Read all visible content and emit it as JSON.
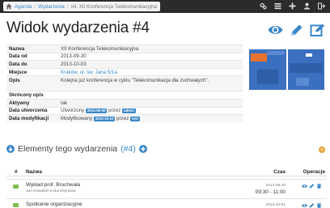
{
  "breadcrumb": {
    "items": [
      "Agenda",
      "Wydarzenia"
    ],
    "current": "#4. XII Konferencja Telekomunikacyjna"
  },
  "page": {
    "title": "Widok wydarzenia #4"
  },
  "details": {
    "name_label": "Nazwa",
    "name_value": "XII Konferencja Telekomunikacyjna",
    "date_from_label": "Data od",
    "date_from_value": "2013-09-30",
    "date_to_label": "Data do",
    "date_to_value": "2013-10-03",
    "place_label": "Miejsce",
    "place_value": "Kraków, ul. św. Jana 5/1a",
    "desc_label": "Opis",
    "desc_value": "Kolejna już konferencja w cyklu \"Telekomunikacja dla zuchwałych\".",
    "short_label": "Skrócony opis",
    "short_value": "",
    "active_label": "Aktywny",
    "active_value": "tak",
    "created_label": "Data utworzenia",
    "created_prefix": "Utworzony",
    "created_date": "2013-09-30",
    "created_mid": "przez",
    "created_user": "admin",
    "modified_label": "Data modyfikacji",
    "modified_prefix": "Modyfikowany",
    "modified_date": "2013-10-10",
    "modified_mid": "przez",
    "modified_user": "test"
  },
  "section": {
    "title": "Elementy tego wydarzenia",
    "count": "(#4)",
    "badge": "0"
  },
  "table": {
    "headers": {
      "num": "#",
      "name": "Nazwa",
      "time": "Czas",
      "ops": "Operacje"
    },
    "rows": [
      {
        "name": "Wykład prof. Bruchwała",
        "sub": "Jan Kowalski w Bursztynowa",
        "date": "2013-09-30",
        "time": "09:30 - 11:00"
      },
      {
        "name": "Spotkanie organizacyjne",
        "sub": "",
        "date": "2013-10-01",
        "time": ""
      }
    ]
  },
  "colors": {
    "accent": "#3a87c8",
    "navbar": "#2b2b2b",
    "badge": "#e8a33c",
    "event_icon": "#7fbf4d"
  },
  "icons": [
    "home-icon",
    "gear-icon",
    "list-icon",
    "plus-icon",
    "user-icon",
    "logout-icon",
    "eye-icon",
    "pencil-icon",
    "edit-icon",
    "arrow-down-circle-icon",
    "plus-circle-icon"
  ]
}
